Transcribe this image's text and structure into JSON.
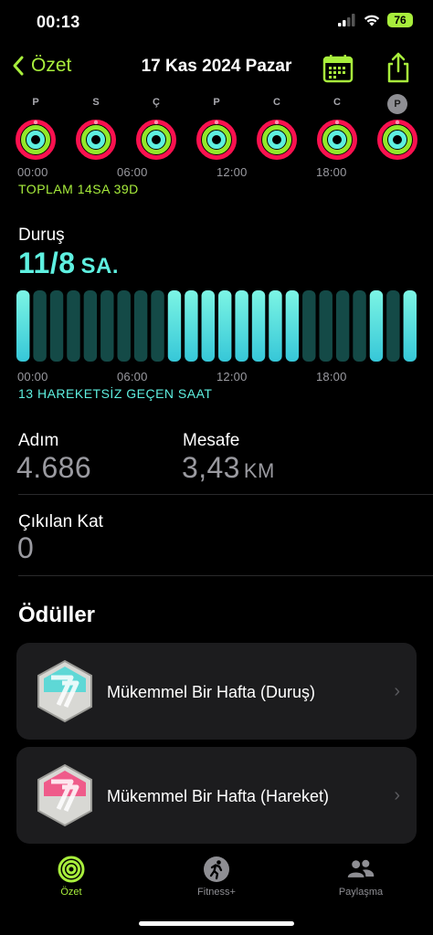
{
  "status": {
    "time": "00:13",
    "battery": "76"
  },
  "nav": {
    "back_label": "Özet",
    "title": "17 Kas 2024 Pazar"
  },
  "week": {
    "days": [
      {
        "letter": "P",
        "selected": false
      },
      {
        "letter": "S",
        "selected": false
      },
      {
        "letter": "Ç",
        "selected": false
      },
      {
        "letter": "P",
        "selected": false
      },
      {
        "letter": "C",
        "selected": false
      },
      {
        "letter": "C",
        "selected": false
      },
      {
        "letter": "P",
        "selected": true
      }
    ]
  },
  "exercise_timeline": {
    "ticks": [
      "00:00",
      "06:00",
      "12:00",
      "18:00"
    ],
    "total_label": "TOPLAM 14SA 39D"
  },
  "stand": {
    "label": "Duruş",
    "value": "11/8",
    "unit": "SA.",
    "ticks": [
      "00:00",
      "06:00",
      "12:00",
      "18:00"
    ],
    "caption": "13 HAREKETSİZ GEÇEN SAAT",
    "hours_stood": [
      1,
      0,
      0,
      0,
      0,
      0,
      0,
      0,
      0,
      1,
      1,
      1,
      1,
      1,
      1,
      1,
      1,
      0,
      0,
      0,
      0,
      1,
      0,
      1
    ]
  },
  "steps": {
    "label": "Adım",
    "value": "4.686"
  },
  "distance": {
    "label": "Mesafe",
    "value": "3,43",
    "unit": "KM"
  },
  "floors": {
    "label": "Çıkılan Kat",
    "value": "0"
  },
  "awards": {
    "heading": "Ödüller",
    "items": [
      {
        "title": "Mükemmel Bir Hafta (Duruş)",
        "color": "#5ed8d6"
      },
      {
        "title": "Mükemmel Bir Hafta (Hareket)",
        "color": "#ef5b8a"
      }
    ]
  },
  "tabs": [
    {
      "label": "Özet",
      "active": true
    },
    {
      "label": "Fitness+",
      "active": false
    },
    {
      "label": "Paylaşma",
      "active": false
    }
  ],
  "colors": {
    "accent_green": "#a8ee3c",
    "stand_cyan": "#5ef0e0",
    "move_red": "#fa114f",
    "exercise_green": "#92e82a",
    "stand_dark": "#144a47"
  }
}
